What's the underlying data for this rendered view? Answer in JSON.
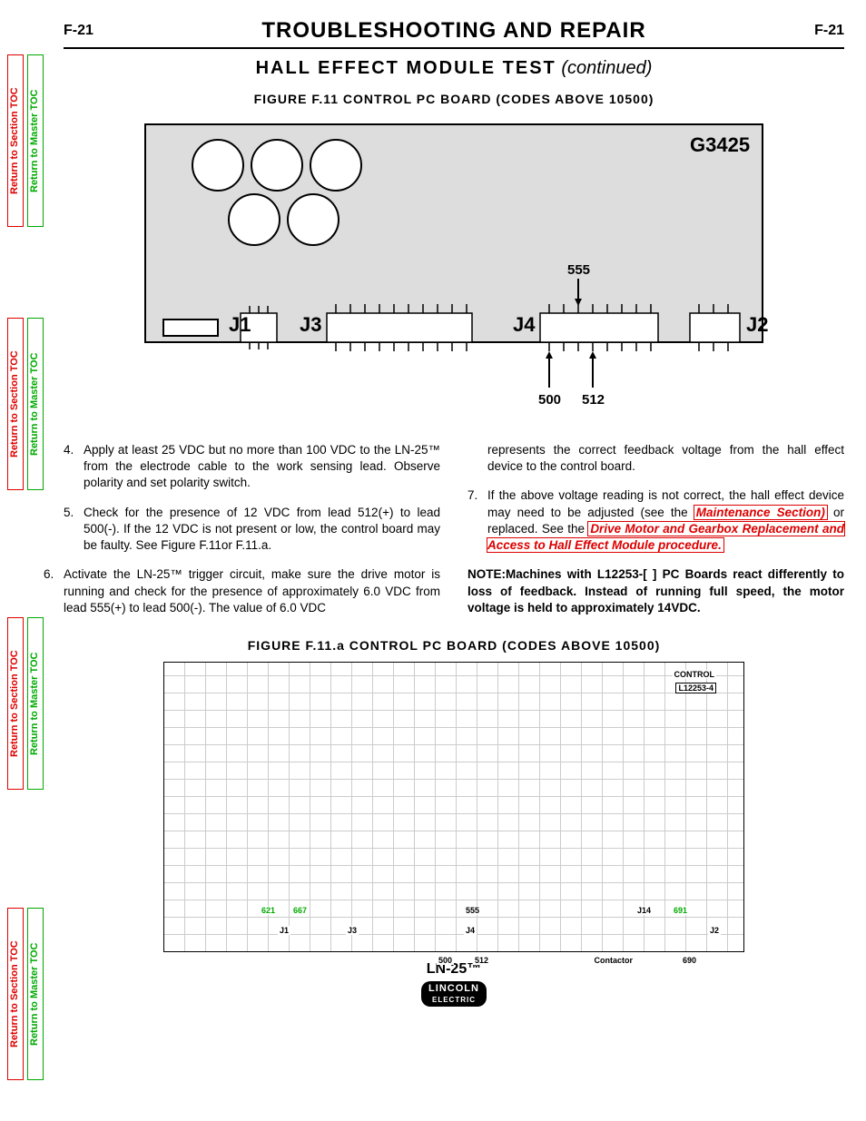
{
  "page_number": "F-21",
  "main_title": "TROUBLESHOOTING  AND  REPAIR",
  "sub_title_bold": "HALL  EFFECT  MODULE  TEST",
  "sub_title_ital": "(continued)",
  "fig_caption_1": "FIGURE  F.11  CONTROL  PC  BOARD  (CODES  ABOVE  10500)",
  "fig_caption_2": "FIGURE  F.11.a  CONTROL  PC  BOARD  (CODES  ABOVE  10500)",
  "diagram": {
    "board_label": "G3425",
    "j1": "J1",
    "j2": "J2",
    "j3": "J3",
    "j4": "J4",
    "pin_500": "500",
    "pin_512": "512",
    "pin_555": "555"
  },
  "tabs": {
    "section": "Return to Section TOC",
    "master": "Return to Master TOC"
  },
  "steps": {
    "s4_num": "4.",
    "s4": "Apply at least 25 VDC but no more than 100 VDC to the LN-25™ from the electrode cable to the work sensing lead. Observe polarity and set polarity switch.",
    "s5_num": "5.",
    "s5": "Check for the presence of 12 VDC from lead 512(+) to lead 500(-). If the 12 VDC is not present or low, the control board may be faulty. See Figure F.11or F.11.a.",
    "s6_num": "6.",
    "s6": "Activate the LN-25™ trigger circuit, make sure the drive motor is running and check for the presence of approximately 6.0 VDC from lead 555(+) to lead 500(-). The value of 6.0 VDC",
    "s6_cont": "represents the correct feedback voltage from the hall effect device to the control board.",
    "s7_num": "7.",
    "s7_a": "If the above voltage reading is not correct, the hall effect device may need to be adjusted (see the ",
    "s7_link1": "Maintenance Section)",
    "s7_b": " or replaced. See the ",
    "s7_link2": "Drive Motor and Gearbox Replacement and Access to Hall Effect Module procedure.",
    "note_label": "NOTE:",
    "note": "Machines with L12253-[ ] PC Boards react differently to loss of feedback. Instead of running full speed, the motor voltage is held to approximately 14VDC."
  },
  "pcb_labels": {
    "control": "CONTROL",
    "part": "L12253-4",
    "j1": "J1",
    "j3": "J3",
    "j4": "J4",
    "j2": "J2",
    "j14": "J14",
    "n621": "621",
    "n667": "667",
    "n555": "555",
    "n500": "500",
    "n512": "512",
    "n690": "690",
    "n691": "691",
    "contactor": "Contactor"
  },
  "footer_model": "LN-25™",
  "footer_brand": "LINCOLN",
  "footer_brand_sub": "ELECTRIC"
}
